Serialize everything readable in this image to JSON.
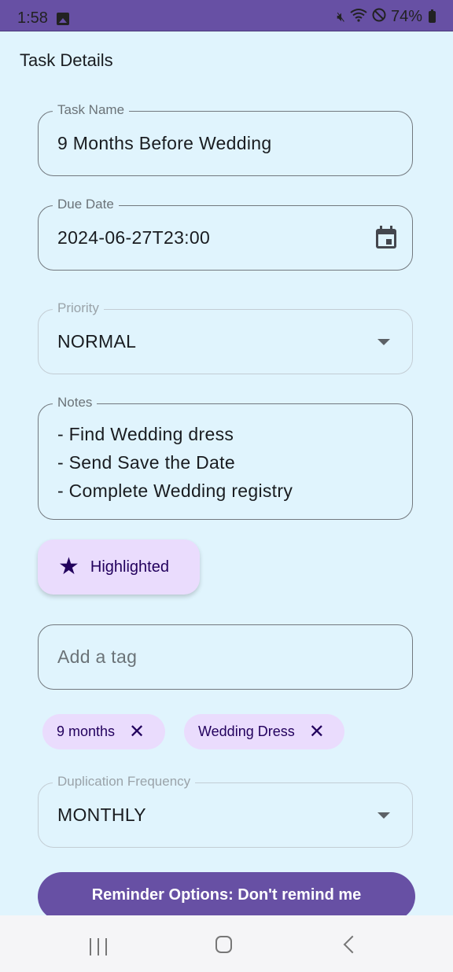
{
  "status_bar": {
    "time": "1:58",
    "battery": "74%",
    "icons": [
      "gallery-icon",
      "mute-icon",
      "wifi-icon",
      "do-not-disturb-icon",
      "battery-charging-icon"
    ]
  },
  "page": {
    "title": "Task Details"
  },
  "form": {
    "task_name": {
      "label": "Task Name",
      "value": "9 Months Before Wedding"
    },
    "due_date": {
      "label": "Due Date",
      "value": "2024-06-27T23:00",
      "icon": "calendar-icon"
    },
    "priority": {
      "label": "Priority",
      "value": "NORMAL",
      "icon": "dropdown-arrow-icon"
    },
    "notes": {
      "label": "Notes",
      "lines": [
        "- Find Wedding dress",
        "- Send Save the Date",
        "- Complete Wedding registry"
      ]
    },
    "highlight": {
      "label": "Highlighted",
      "icon": "star-icon"
    },
    "tag_input": {
      "placeholder": "Add a tag",
      "value": ""
    },
    "tags": [
      {
        "label": "9 months",
        "icon": "close-icon"
      },
      {
        "label": "Wedding Dress",
        "icon": "close-icon"
      }
    ],
    "duplication": {
      "label": "Duplication Frequency",
      "value": "MONTHLY",
      "icon": "dropdown-arrow-icon"
    },
    "reminder_button": {
      "label": "Reminder Options: Don't remind me"
    }
  },
  "nav_bar": {
    "buttons": [
      "recents",
      "home",
      "back"
    ]
  },
  "colors": {
    "primary": "#6750a4",
    "background": "#e0f4fd",
    "chip": "#eadcfd",
    "on_chip": "#22005d"
  }
}
